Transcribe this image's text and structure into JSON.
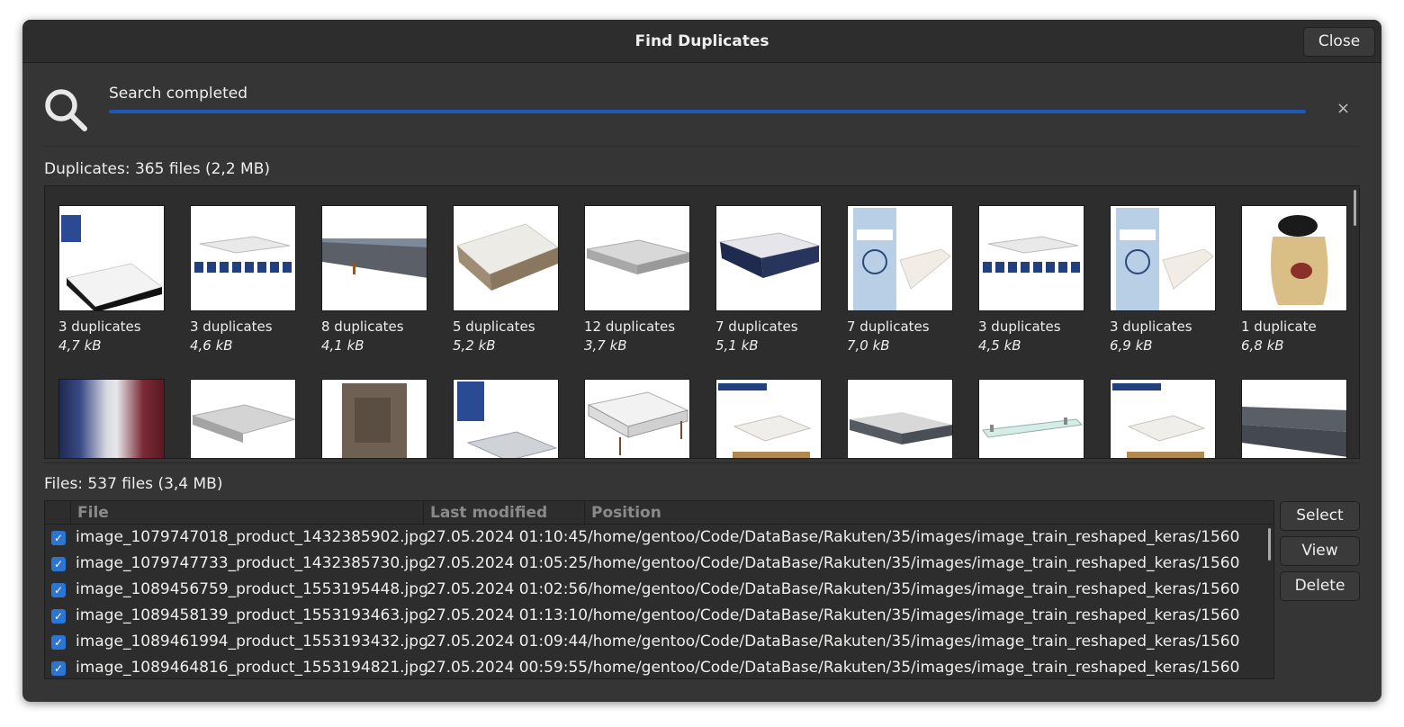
{
  "window": {
    "title": "Find Duplicates",
    "close_label": "Close"
  },
  "search": {
    "status": "Search completed",
    "progress": 1.0,
    "dismiss_glyph": "×"
  },
  "duplicates": {
    "label": "Duplicates: 365 files (2,2 MB)",
    "items": [
      {
        "count": "3 duplicates",
        "size": "4,7 kB"
      },
      {
        "count": "3 duplicates",
        "size": "4,6 kB"
      },
      {
        "count": "8 duplicates",
        "size": "4,1 kB"
      },
      {
        "count": "5 duplicates",
        "size": "5,2 kB"
      },
      {
        "count": "12 duplicates",
        "size": "3,7 kB"
      },
      {
        "count": "7 duplicates",
        "size": "5,1 kB"
      },
      {
        "count": "7 duplicates",
        "size": "7,0 kB"
      },
      {
        "count": "3 duplicates",
        "size": "4,5 kB"
      },
      {
        "count": "3 duplicates",
        "size": "6,9 kB"
      },
      {
        "count": "1 duplicate",
        "size": "6,8 kB"
      }
    ]
  },
  "files": {
    "label": "Files: 537 files (3,4 MB)",
    "columns": {
      "file": "File",
      "modified": "Last modified",
      "position": "Position"
    },
    "rows": [
      {
        "checked": true,
        "file": "image_1079747018_product_1432385902.jpg",
        "modified": "27.05.2024 01:10:45",
        "position": "/home/gentoo/Code/DataBase/Rakuten/35/images/image_train_reshaped_keras/1560"
      },
      {
        "checked": true,
        "file": "image_1079747733_product_1432385730.jpg",
        "modified": "27.05.2024 01:05:25",
        "position": "/home/gentoo/Code/DataBase/Rakuten/35/images/image_train_reshaped_keras/1560"
      },
      {
        "checked": true,
        "file": "image_1089456759_product_1553195448.jpg",
        "modified": "27.05.2024 01:02:56",
        "position": "/home/gentoo/Code/DataBase/Rakuten/35/images/image_train_reshaped_keras/1560"
      },
      {
        "checked": true,
        "file": "image_1089458139_product_1553193463.jpg",
        "modified": "27.05.2024 01:13:10",
        "position": "/home/gentoo/Code/DataBase/Rakuten/35/images/image_train_reshaped_keras/1560"
      },
      {
        "checked": true,
        "file": "image_1089461994_product_1553193432.jpg",
        "modified": "27.05.2024 01:09:44",
        "position": "/home/gentoo/Code/DataBase/Rakuten/35/images/image_train_reshaped_keras/1560"
      },
      {
        "checked": true,
        "file": "image_1089464816_product_1553194821.jpg",
        "modified": "27.05.2024 00:59:55",
        "position": "/home/gentoo/Code/DataBase/Rakuten/35/images/image_train_reshaped_keras/1560"
      }
    ]
  },
  "actions": {
    "select_label": "Select",
    "view_label": "View",
    "delete_label": "Delete"
  },
  "colors": {
    "window_bg": "#353535",
    "accent": "#2a76d2",
    "progress": "#1c58b8"
  }
}
